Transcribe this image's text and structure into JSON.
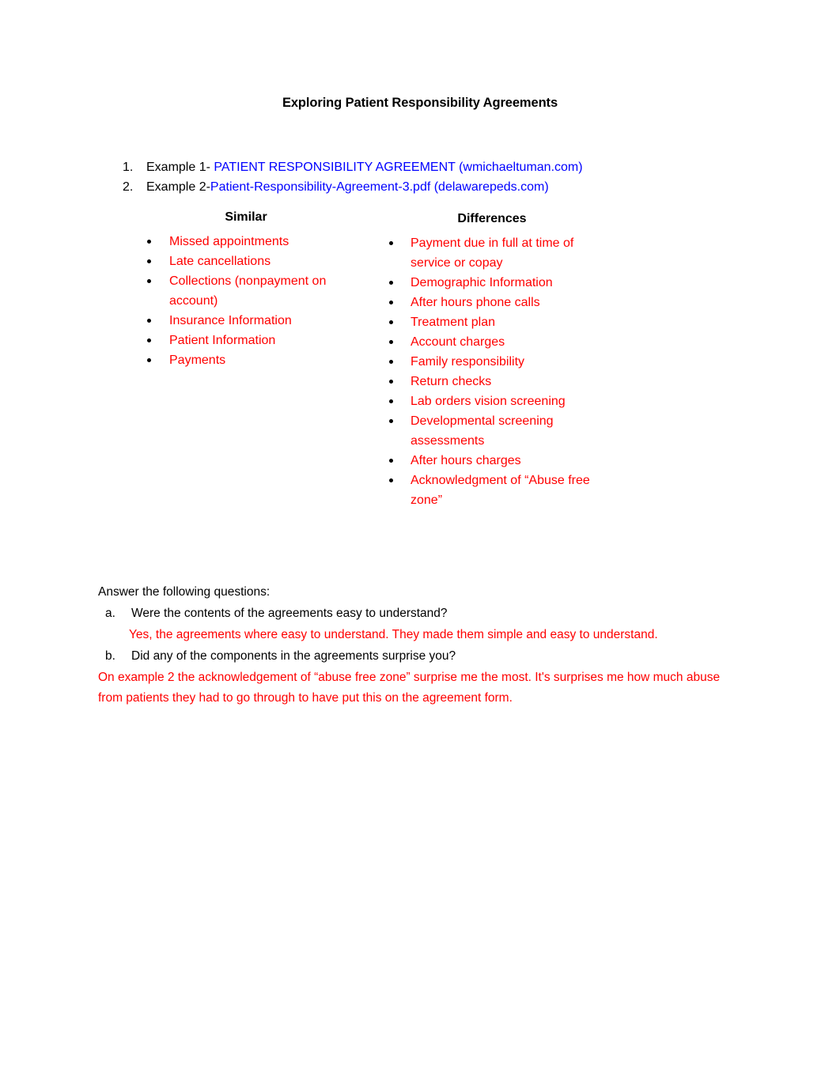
{
  "document": {
    "title": "Exploring Patient Responsibility Agreements"
  },
  "examples": [
    {
      "marker": "1.",
      "label": "Example 1- ",
      "link": "PATIENT RESPONSIBILITY AGREEMENT (wmichaeltuman.com)"
    },
    {
      "marker": "2.",
      "label": "Example 2-",
      "link": "Patient-Responsibility-Agreement-3.pdf (delawarepeds.com)"
    }
  ],
  "comparison": {
    "similar": {
      "heading": "Similar",
      "items": [
        "Missed appointments",
        "Late cancellations",
        "Collections (nonpayment on account)",
        "Insurance Information",
        "Patient Information",
        "Payments"
      ]
    },
    "differences": {
      "heading": "Differences",
      "items": [
        "Payment due in full at time of service or copay",
        "Demographic Information",
        "After hours phone calls",
        "Treatment plan",
        "Account charges",
        "Family responsibility",
        "Return checks",
        "Lab orders vision screening",
        "Developmental screening assessments",
        "After hours charges",
        "Acknowledgment of “Abuse free zone”"
      ]
    }
  },
  "questions": {
    "intro": "Answer the following questions:",
    "items": [
      {
        "marker": "a.",
        "question": "Were the contents of the agreements easy to understand?",
        "answer": "Yes, the agreements where easy to understand. They made them simple and easy to understand."
      },
      {
        "marker": "b.",
        "question": "Did any of the components in the agreements surprise you?",
        "answer": ""
      }
    ],
    "final_answer": "On example 2 the acknowledgement of “abuse free zone” surprise me the most. It's surprises me how much abuse from patients they had to go through to have put this on the agreement form."
  },
  "colors": {
    "link": "#0000FF",
    "answer_red": "#FF0000",
    "body_text": "#000000",
    "page_background": "#FFFFFF"
  }
}
